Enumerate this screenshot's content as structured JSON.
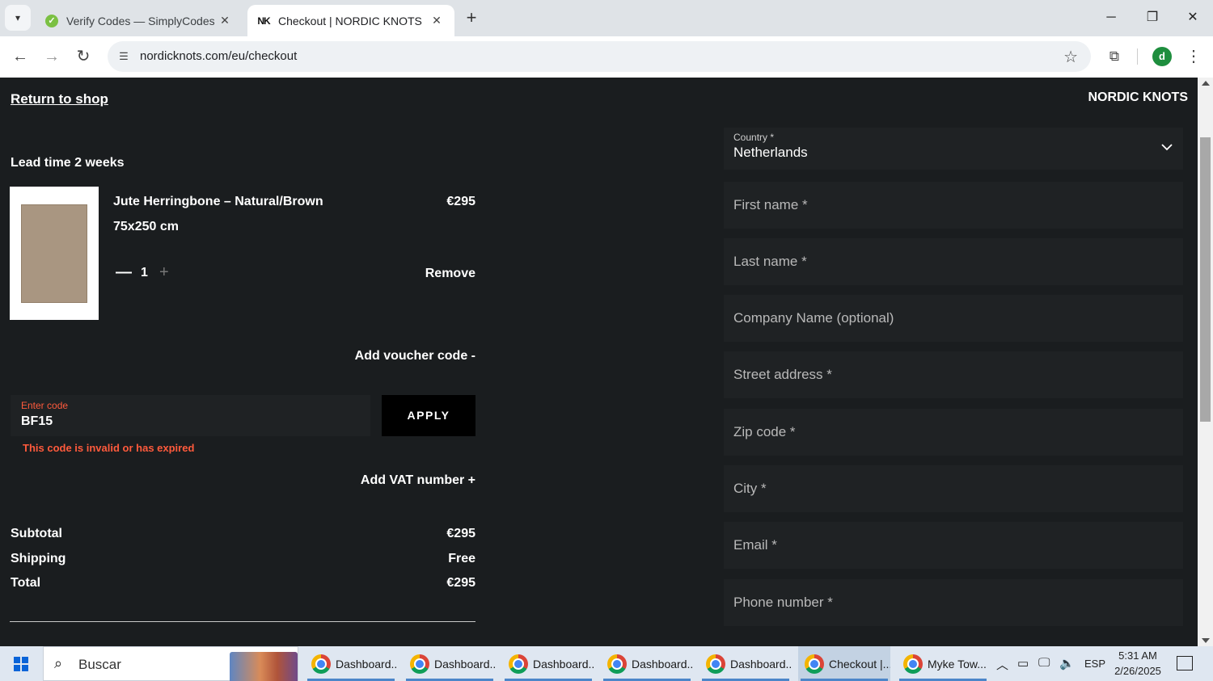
{
  "browser": {
    "tabs": [
      {
        "title": "Verify Codes — SimplyCodes",
        "favicon": "simplycodes-icon",
        "active": false
      },
      {
        "title": "Checkout | NORDIC KNOTS",
        "favicon": "nordic-knots-icon",
        "favicon_text": "NK",
        "active": true
      }
    ],
    "url": "nordicknots.com/eu/checkout",
    "profile_initial": "d"
  },
  "page": {
    "return_link": "Return to shop",
    "brand": "NORDIC KNOTS",
    "lead_time": "Lead time 2 weeks",
    "product": {
      "name": "Jute Herringbone – Natural/Brown",
      "size": "75x250 cm",
      "price": "€295",
      "quantity": "1",
      "minus": "—",
      "plus": "+",
      "remove": "Remove"
    },
    "voucher": {
      "toggle": "Add voucher code -",
      "label": "Enter code",
      "value": "BF15",
      "apply": "APPLY",
      "error": "This code is invalid or has expired"
    },
    "vat_toggle": "Add VAT number +",
    "summary": {
      "subtotal_label": "Subtotal",
      "subtotal_value": "€295",
      "shipping_label": "Shipping",
      "shipping_value": "Free",
      "total_label": "Total",
      "total_value": "€295"
    },
    "form": {
      "country_label": "Country *",
      "country_value": "Netherlands",
      "first_name": "First name *",
      "last_name": "Last name *",
      "company": "Company Name (optional)",
      "street": "Street address *",
      "zip": "Zip code *",
      "city": "City *",
      "email": "Email *",
      "phone": "Phone number *"
    }
  },
  "taskbar": {
    "search": "Buscar",
    "apps": [
      {
        "label": "Dashboard...",
        "active": false
      },
      {
        "label": "Dashboard...",
        "active": false
      },
      {
        "label": "Dashboard...",
        "active": false
      },
      {
        "label": "Dashboard...",
        "active": false
      },
      {
        "label": "Dashboard...",
        "active": false
      },
      {
        "label": "Checkout |...",
        "active": true
      },
      {
        "label": "Myke Tow...",
        "active": false
      }
    ],
    "language": "ESP",
    "time": "5:31 AM",
    "date": "2/26/2025"
  },
  "colors": {
    "page_bg": "#1a1d1f",
    "field_bg": "#1f2224",
    "error": "#ff5a3c",
    "apply_bg": "#000000"
  }
}
